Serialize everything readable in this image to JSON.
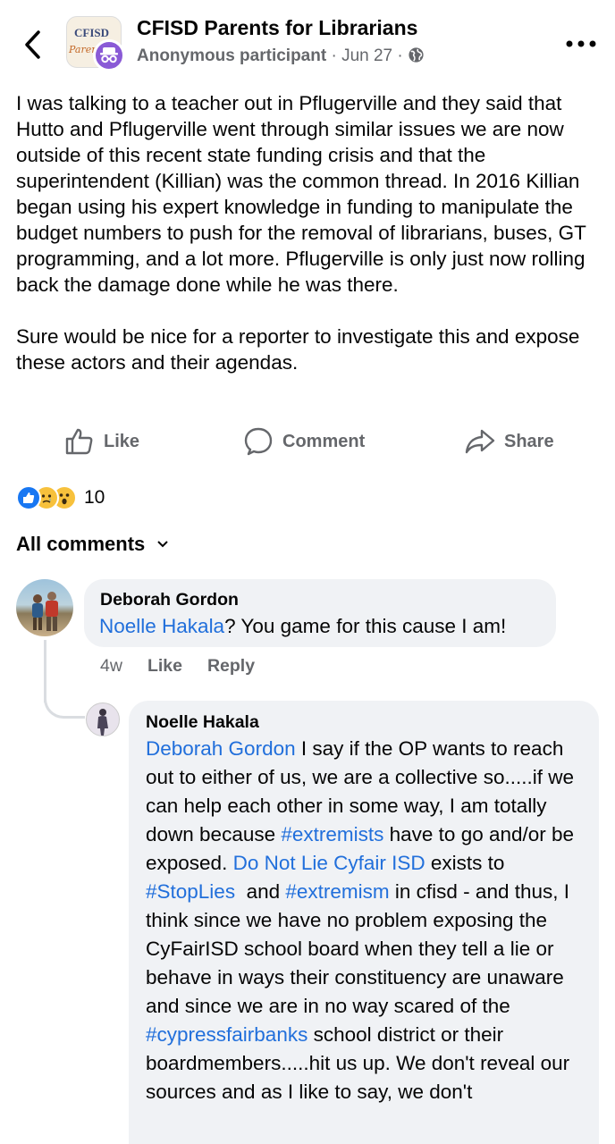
{
  "header": {
    "group_name": "CFISD Parents for Librarians",
    "author": "Anonymous participant",
    "separator": " · ",
    "date": "Jun 27",
    "separator2": " · ",
    "group_logo_text": "CFISD",
    "group_logo_script": "Parents"
  },
  "post": {
    "paragraph1": "I was talking to a teacher out in Pflugerville and they said that Hutto and Pflugerville went through similar issues we are now outside of this recent state funding crisis and that the superintendent (Killian) was the common thread. In 2016 Killian began using his expert knowledge in funding to manipulate the budget numbers to push for the removal of librarians, buses, GT programming, and a lot more. Pflugerville is only just now rolling back the damage done while he was there.",
    "paragraph2": "Sure would be nice for a reporter to investigate this and expose these actors and their agendas."
  },
  "actions": {
    "like": "Like",
    "comment": "Comment",
    "share": "Share"
  },
  "reactions": {
    "count": "10"
  },
  "comments_header": {
    "label": "All comments"
  },
  "comment1": {
    "author": "Deborah Gordon",
    "mention": "Noelle Hakala",
    "text": "? You game for this cause I am!",
    "time": "4w",
    "like": "Like",
    "reply": "Reply"
  },
  "comment2": {
    "author": "Noelle Hakala",
    "mention": "Deborah Gordon",
    "t1": " I say if the OP wants to reach out to either of us, we are a collective so.....if we can help each other in some way, I am totally down because ",
    "tag1": "#extremists",
    "t2": " have to go and/or be exposed. ",
    "mention2": "Do Not Lie Cyfair ISD",
    "t3": " exists to ",
    "tag2": "#StopLies",
    "t4": "  and ",
    "tag3": "#extremism",
    "t5": " in cfisd - and thus, I think since we have no problem exposing the CyFairISD school board when they tell a lie or behave in ways their constituency are unaware and since we are in no way scared of the ",
    "tag4": "#cypressfairbanks",
    "t6": " school district or their boardmembers.....hit us up. We don't reveal our sources and as I like to say, we don't"
  },
  "colors": {
    "link": "#216fdb",
    "secondary": "#65676b",
    "bubble": "#f0f2f5"
  }
}
